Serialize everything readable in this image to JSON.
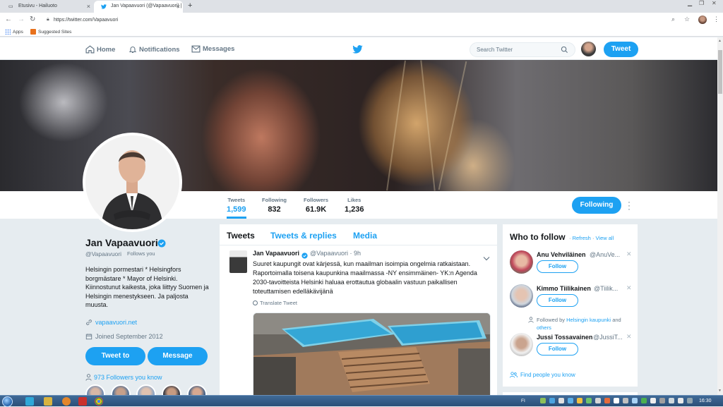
{
  "browser": {
    "tabs": [
      {
        "title": "Etusivu - Hailuoto",
        "active": false
      },
      {
        "title": "Jan Vapaavuori (@Vapaavuori) |",
        "active": true
      }
    ],
    "new_tab_symbol": "+",
    "url": "https://twitter.com/Vapaavuori",
    "bookmarks": [
      {
        "label": "Apps",
        "icon": "apps-grid-icon"
      },
      {
        "label": "Suggested Sites",
        "icon": "suggested-sites-icon"
      }
    ]
  },
  "twitter_nav": {
    "home": "Home",
    "notifications": "Notifications",
    "messages": "Messages",
    "search_placeholder": "Search Twitter",
    "tweet_button": "Tweet"
  },
  "profile": {
    "name": "Jan Vapaavuori",
    "handle": "@Vapaavuori",
    "follows_you": "Follows you",
    "bio": "Helsingin pormestari * Helsingfors borgmästare * Mayor of Helsinki. Kiinnostunut kaikesta, joka liittyy Suomen ja Helsingin menestykseen. Ja paljosta muusta.",
    "website": "vapaavuori.net",
    "joined": "Joined September 2012",
    "tweet_to": "Tweet to",
    "message": "Message",
    "followers_you_know": "973 Followers you know",
    "following_button": "Following"
  },
  "stats": [
    {
      "label": "Tweets",
      "value": "1,599",
      "active": true
    },
    {
      "label": "Following",
      "value": "832",
      "active": false
    },
    {
      "label": "Followers",
      "value": "61.9K",
      "active": false
    },
    {
      "label": "Likes",
      "value": "1,236",
      "active": false
    }
  ],
  "timeline": {
    "tabs": [
      "Tweets",
      "Tweets & replies",
      "Media"
    ],
    "tweet": {
      "name": "Jan Vapaavuori",
      "handle": "@Vapaavuori",
      "time": "9h",
      "text": "Suuret kaupungit ovat kärjessä, kun maailman isoimpia ongelmia ratkaistaan. Raportoimalla toisena kaupunkina maailmassa -NY ensimmäinen- YK:n Agenda 2030-tavoitteista Helsinki haluaa erottautua globaalin vastuun paikallisen toteuttamisen edelläkävijänä",
      "translate": "Translate Tweet"
    }
  },
  "who_to_follow": {
    "title": "Who to follow",
    "refresh": "Refresh",
    "view_all": "View all",
    "separator": "·",
    "follow_label": "Follow",
    "users": [
      {
        "name": "Anu Vehviläinen",
        "handle": "@AnuVe..."
      },
      {
        "name": "Kimmo Tiilikainen",
        "handle": "@Tiilik..."
      },
      {
        "name": "Jussi Tossavainen",
        "handle": "@JussiT..."
      }
    ],
    "followed_by_prefix": "Followed by",
    "followed_by_link": "Helsingin kaupunki",
    "followed_by_and": "and",
    "followed_by_others": "others",
    "find_people": "Find people you know"
  },
  "taskbar": {
    "language": "FI",
    "time": "16:30"
  },
  "colors": {
    "twitter_blue": "#1da1f2",
    "text_primary": "#14171a",
    "text_secondary": "#657786",
    "page_bg": "#e6ecf0"
  }
}
